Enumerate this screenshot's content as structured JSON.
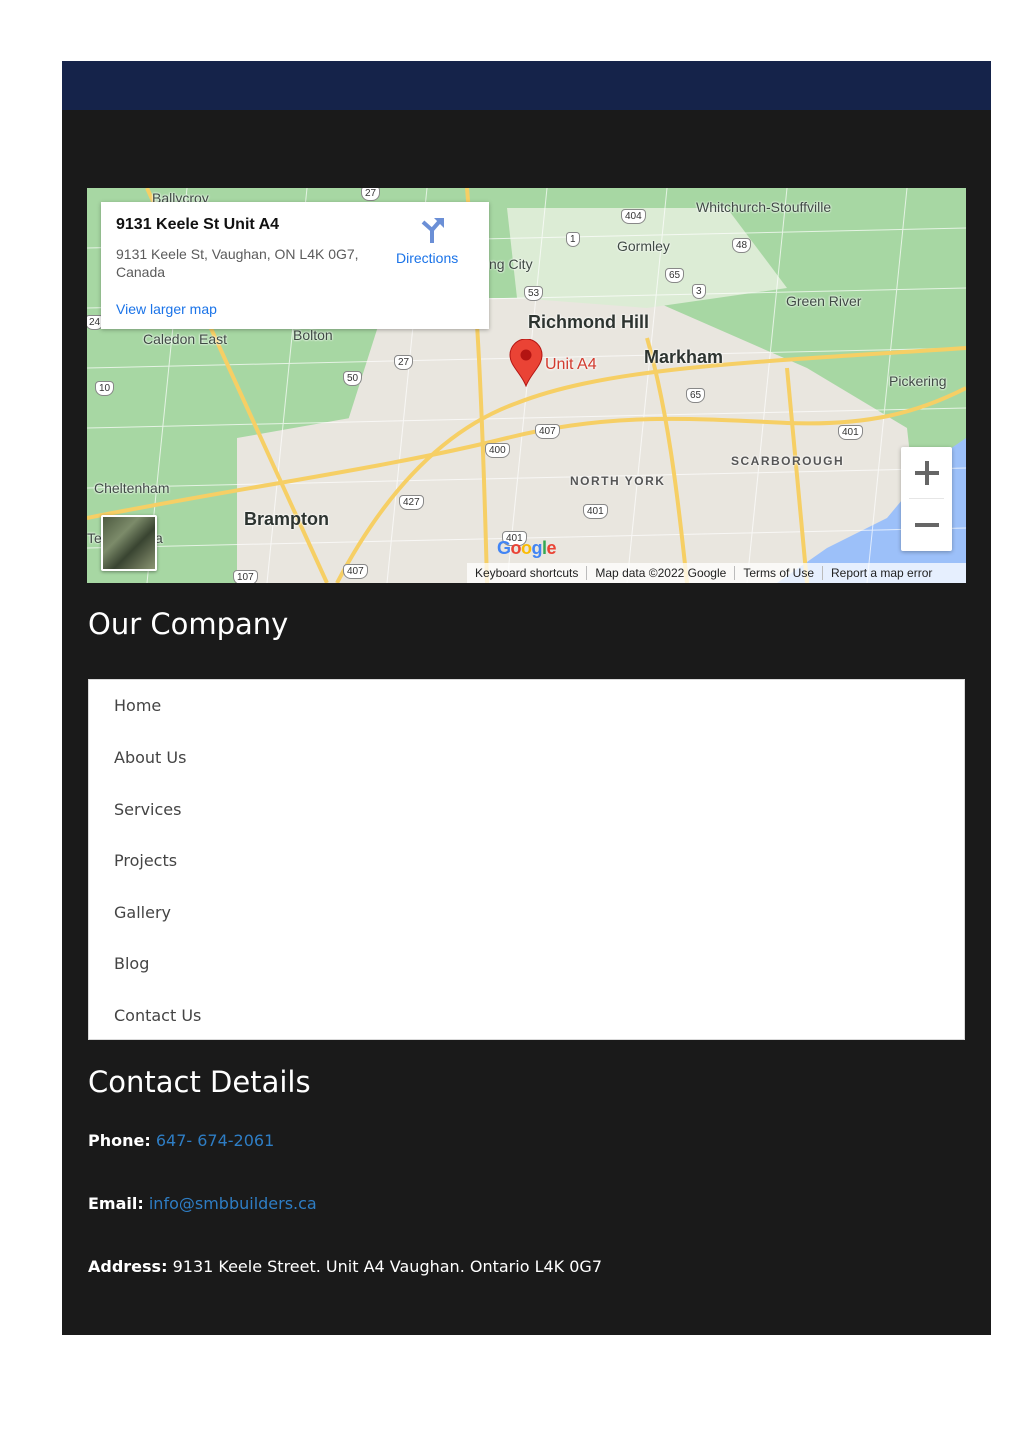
{
  "map": {
    "card": {
      "title": "9131 Keele St Unit A4",
      "address": "9131 Keele St, Vaughan, ON L4K 0G7, Canada",
      "larger_map_link": "View larger map",
      "directions_label": "Directions"
    },
    "marker_label": "Unit A4",
    "places": {
      "ballycroy": "Ballycroy",
      "whitchurch": "Whitchurch-Stouffville",
      "gormley": "Gormley",
      "king_city": "ng City",
      "green_river": "Green River",
      "richmond_hill": "Richmond Hill",
      "caledon_east": "Caledon East",
      "bolton": "Bolton",
      "markham": "Markham",
      "pickering": "Pickering",
      "scarborough": "SCARBOROUGH",
      "north_york": "NORTH YORK",
      "cheltenham": "Cheltenham",
      "brampton": "Brampton",
      "te": "Te",
      "a_frag": "a"
    },
    "shields": [
      "27",
      "404",
      "1",
      "48",
      "65",
      "3",
      "53",
      "24",
      "27",
      "50",
      "10",
      "65",
      "407",
      "401",
      "400",
      "427",
      "401",
      "401",
      "107",
      "407"
    ],
    "zoom_in": "+",
    "zoom_out": "−",
    "google_logo": "Google",
    "attribution": {
      "shortcuts": "Keyboard shortcuts",
      "map_data": "Map data ©2022 Google",
      "terms": "Terms of Use",
      "report": "Report a map error"
    },
    "colors": {
      "land": "#a7d7a3",
      "water": "#9cc0f9",
      "urban": "#e9e6df",
      "highway": "#f6cf65",
      "marker": "#ea4335"
    }
  },
  "company": {
    "heading": "Our Company",
    "nav": [
      "Home",
      "About Us",
      "Services",
      "Projects",
      "Gallery",
      "Blog",
      "Contact Us"
    ]
  },
  "contact": {
    "heading": "Contact Details",
    "phone_label": "Phone:",
    "phone": "647- 674-2061",
    "email_label": "Email:",
    "email": "info@smbbuilders.ca",
    "address_label": "Address:",
    "address": "9131 Keele Street. Unit A4 Vaughan. Ontario L4K 0G7"
  },
  "theme": {
    "topbar": "#15234a",
    "background": "#1a1a1a",
    "link": "#2e7dc4"
  }
}
